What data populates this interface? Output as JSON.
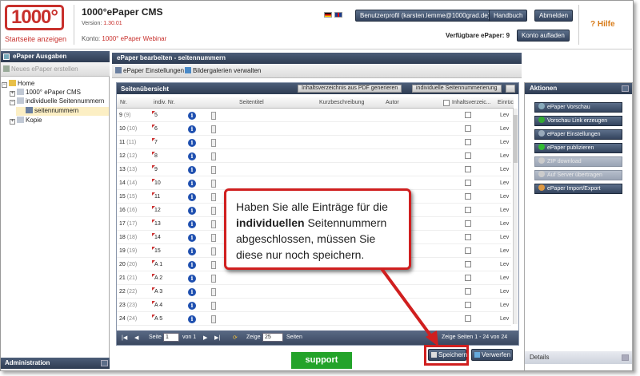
{
  "header": {
    "logo_text": "1000°",
    "logo_sub": "Startseite anzeigen",
    "cms_title": "1000°ePaper CMS",
    "version_label": "Version:",
    "version_value": "1.30.01",
    "konto_label": "Konto:",
    "konto_value": "1000° ePaper Webinar",
    "profile_button": "Benutzerprofil (karsten.lemme@1000grad.de)",
    "handbuch_button": "Handbuch",
    "abmelden_button": "Abmelden",
    "verfuegbare_label": "Verfügbare ePaper: 9",
    "konto_aufladen_button": "Konto aufladen",
    "hilfe_label": "? Hilfe"
  },
  "left_panel": {
    "title": "ePaper Ausgaben",
    "new_button": "Neues ePaper erstellen",
    "tree": [
      {
        "label": "Home",
        "toggle": "−"
      },
      {
        "label": "1000° ePaper CMS",
        "toggle": "+"
      },
      {
        "label": "individuelle Seitennummern",
        "toggle": "−"
      },
      {
        "label": "seitennummern",
        "toggle": ""
      },
      {
        "label": "Kopie",
        "toggle": "+"
      }
    ],
    "admin_label": "Administration"
  },
  "center": {
    "title": "ePaper bearbeiten - seitennummern",
    "toolbar": {
      "einstellungen": "ePaper Einstellungen",
      "bildergalerien": "Bildergalerien verwalten"
    },
    "grid": {
      "title": "Seitenübersicht",
      "btn_pdf": "Inhaltsverzeichnis aus PDF generieren",
      "btn_individual": "individuelle Seitennummerierung",
      "columns": [
        "Nr.",
        "indiv. Nr.",
        "Seitentitel",
        "Kurzbeschreibung",
        "Autor",
        "Inhaltsverzeic...",
        "Einrüc"
      ],
      "rows": [
        {
          "nr": "9",
          "nr2": "(9)",
          "ind": "5"
        },
        {
          "nr": "10",
          "nr2": "(10)",
          "ind": "6"
        },
        {
          "nr": "11",
          "nr2": "(11)",
          "ind": "7"
        },
        {
          "nr": "12",
          "nr2": "(12)",
          "ind": "8"
        },
        {
          "nr": "13",
          "nr2": "(13)",
          "ind": "9"
        },
        {
          "nr": "14",
          "nr2": "(14)",
          "ind": "10"
        },
        {
          "nr": "15",
          "nr2": "(15)",
          "ind": "11"
        },
        {
          "nr": "16",
          "nr2": "(16)",
          "ind": "12"
        },
        {
          "nr": "17",
          "nr2": "(17)",
          "ind": "13"
        },
        {
          "nr": "18",
          "nr2": "(18)",
          "ind": "14"
        },
        {
          "nr": "19",
          "nr2": "(19)",
          "ind": "15"
        },
        {
          "nr": "20",
          "nr2": "(20)",
          "ind": "A 1"
        },
        {
          "nr": "21",
          "nr2": "(21)",
          "ind": "A 2"
        },
        {
          "nr": "22",
          "nr2": "(22)",
          "ind": "A 3"
        },
        {
          "nr": "23",
          "nr2": "(23)",
          "ind": "A 4"
        },
        {
          "nr": "24",
          "nr2": "(24)",
          "ind": "A 5"
        }
      ],
      "level_text": "Lev",
      "pager": {
        "seite_label": "Seite",
        "page_value": "1",
        "von_label": "von 1",
        "zeige_label": "Zeige",
        "per_page": "25",
        "seiten_label": "Seiten",
        "summary": "Zeige Seiten 1 - 24 von 24"
      }
    }
  },
  "actions": {
    "title": "Aktionen",
    "buttons": [
      {
        "label": "ePaper Vorschau",
        "enabled": true
      },
      {
        "label": "Vorschau Link erzeugen",
        "enabled": true
      },
      {
        "label": "ePaper Einstellungen",
        "enabled": true
      },
      {
        "label": "ePaper publizieren",
        "enabled": true
      },
      {
        "label": "ZIP download",
        "enabled": false
      },
      {
        "label": "Auf Server übertragen",
        "enabled": false
      },
      {
        "label": "ePaper Import/Export",
        "enabled": true
      }
    ],
    "details_label": "Details"
  },
  "bottom": {
    "support_button": "support",
    "save_button": "Speichern",
    "discard_button": "Verwerfen"
  },
  "callout": {
    "part1": "Haben Sie alle Einträge für die ",
    "bold": "individuellen",
    "part2": " Seitennummern abgeschlossen, müssen Sie diese nur noch speichern."
  },
  "colors": {
    "accent_red": "#c8302c",
    "panel_dark": "#34445e",
    "support_green": "#23a32a",
    "hilfe_orange": "#d87c1a"
  }
}
